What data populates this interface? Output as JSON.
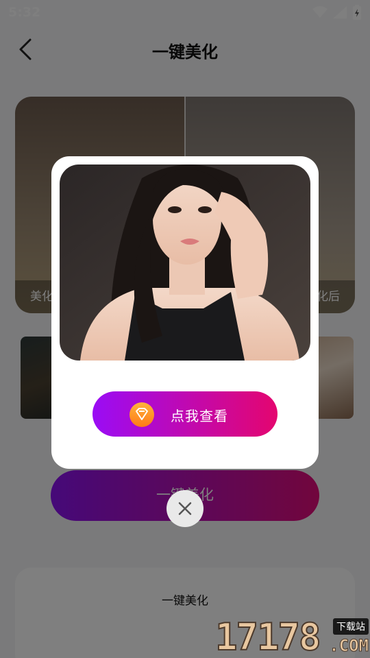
{
  "status_bar": {
    "time": "5:32"
  },
  "header": {
    "title": "一键美化"
  },
  "compare": {
    "before_label": "美化",
    "after_label": "化后"
  },
  "beautify_button": {
    "label": "一键美化"
  },
  "bottom_card": {
    "title": "一键美化"
  },
  "popup": {
    "cta_label": "点我查看"
  },
  "watermark": {
    "number": "17178",
    "site": "下载站",
    "domain": ".COM"
  },
  "colors": {
    "cta_gradient_start": "#9a0cf5",
    "cta_gradient_end": "#e4066f",
    "cta_icon": "#ff9a2e",
    "overlay": "#000000"
  },
  "icons": [
    "wifi-icon",
    "signal-icon",
    "battery-icon",
    "back-arrow-icon",
    "diamond-icon",
    "close-icon"
  ]
}
